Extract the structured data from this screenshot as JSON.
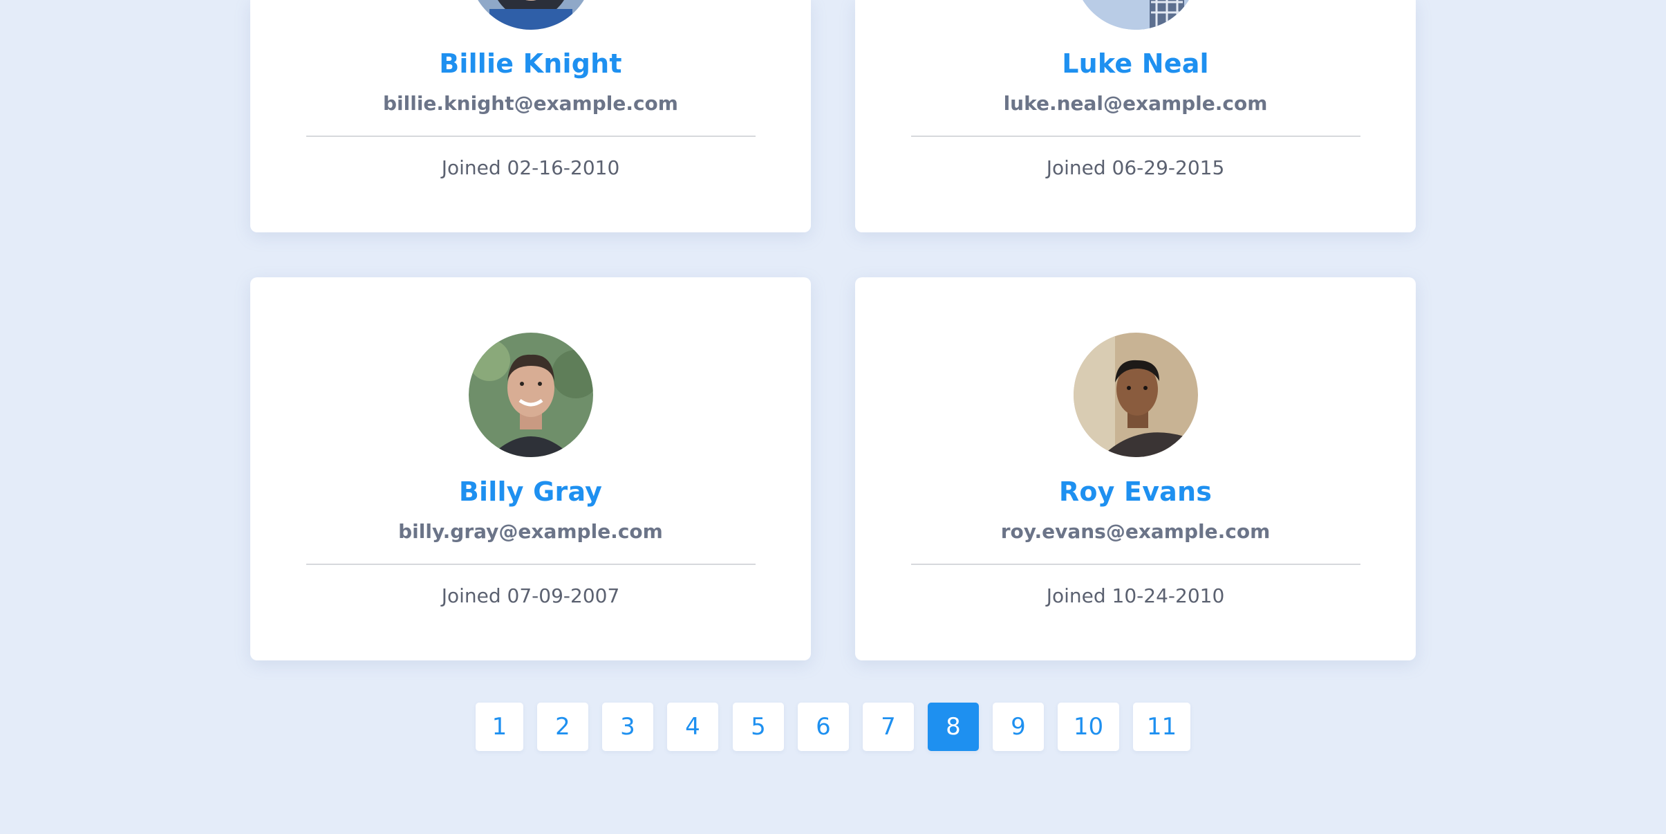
{
  "colors": {
    "background": "#e4ecf9",
    "accent": "#1e90f0",
    "card": "#ffffff",
    "email_text": "#6b7488",
    "joined_text": "#5b6170"
  },
  "users": [
    {
      "name": "Billie Knight",
      "email": "billie.knight@example.com",
      "joined": "Joined 02-16-2010",
      "avatar_icon": "avatar-photo"
    },
    {
      "name": "Luke Neal",
      "email": "luke.neal@example.com",
      "joined": "Joined 06-29-2015",
      "avatar_icon": "avatar-photo"
    },
    {
      "name": "Billy Gray",
      "email": "billy.gray@example.com",
      "joined": "Joined 07-09-2007",
      "avatar_icon": "avatar-photo"
    },
    {
      "name": "Roy Evans",
      "email": "roy.evans@example.com",
      "joined": "Joined 10-24-2010",
      "avatar_icon": "avatar-photo"
    }
  ],
  "pagination": {
    "pages": [
      "1",
      "2",
      "3",
      "4",
      "5",
      "6",
      "7",
      "8",
      "9",
      "10",
      "11"
    ],
    "current": "8"
  }
}
